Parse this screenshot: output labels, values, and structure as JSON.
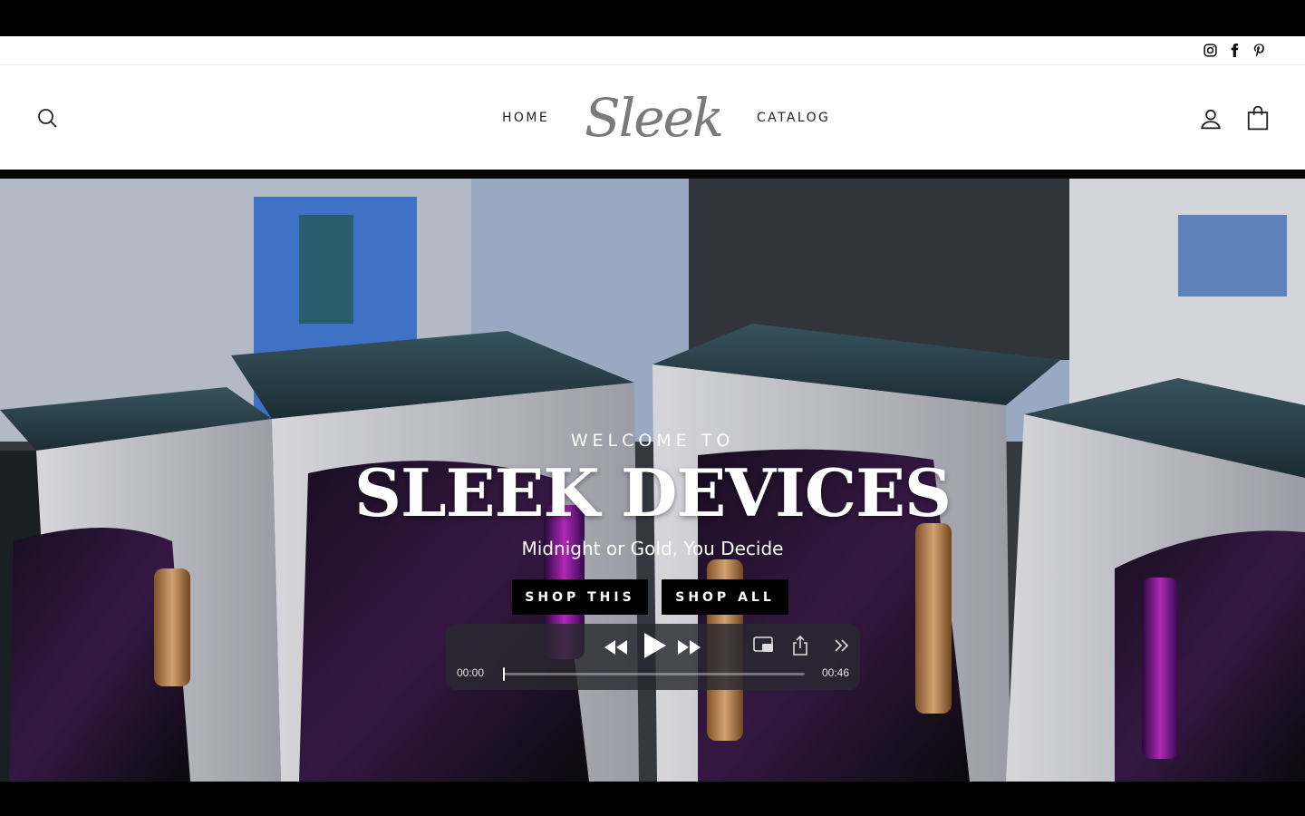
{
  "social": {
    "items": [
      {
        "name": "Instagram",
        "icon": "instagram-icon"
      },
      {
        "name": "Facebook",
        "icon": "facebook-icon"
      },
      {
        "name": "Pinterest",
        "icon": "pinterest-icon"
      }
    ]
  },
  "header": {
    "search_icon": "search-icon",
    "nav_home": "HOME",
    "logo_text": "Sleek",
    "nav_catalog": "CATALOG",
    "account_icon": "user-icon",
    "cart_icon": "shopping-bag-icon"
  },
  "hero": {
    "welcome": "WELCOME TO",
    "title": "SLEEK DEVICES",
    "subtitle": "Midnight or Gold, You Decide",
    "buttons": {
      "shop_this": "SHOP THIS",
      "shop_all": "SHOP ALL"
    }
  },
  "player": {
    "current_time": "00:00",
    "duration": "00:46",
    "progress": 0.0,
    "controls": [
      "rewind-icon",
      "play-icon",
      "fast-forward-icon",
      "picture-in-picture-icon",
      "share-icon",
      "more-icon"
    ]
  },
  "colors": {
    "header_bg": "#ffffff",
    "text_dark": "#222222",
    "logo_gray": "#7a7a7a",
    "button_bg": "#000000",
    "player_bg": "rgba(40,40,48,0.82)"
  }
}
